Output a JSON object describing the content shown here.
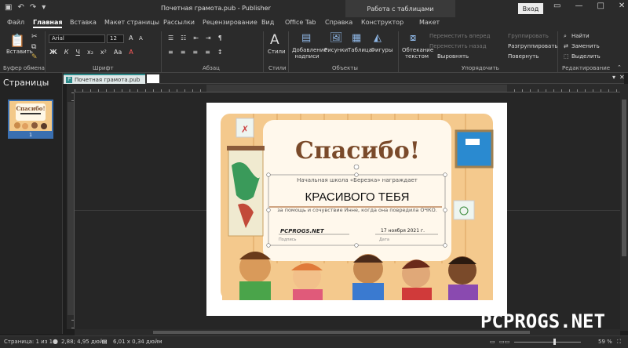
{
  "titlebar": {
    "title": "Почетная грамота.pub  -  Publisher",
    "context_tab": "Работа с таблицами",
    "login": "Вход",
    "qat_icons": [
      "save-icon",
      "undo-icon",
      "redo-icon",
      "customize-icon"
    ]
  },
  "tabs": [
    {
      "label": "Файл"
    },
    {
      "label": "Главная"
    },
    {
      "label": "Вставка"
    },
    {
      "label": "Макет страницы"
    },
    {
      "label": "Рассылки"
    },
    {
      "label": "Рецензирование"
    },
    {
      "label": "Вид"
    },
    {
      "label": "Office Tab"
    },
    {
      "label": "Справка"
    },
    {
      "label": "Конструктор"
    },
    {
      "label": "Макет"
    }
  ],
  "ribbon": {
    "paste": "Вставить",
    "font_name": "Arial",
    "font_size": "12",
    "styles": "Стили",
    "add_textbox": "Добавление надписи",
    "pictures": "Рисунки",
    "table": "Таблица",
    "shapes": "Фигуры",
    "wrap_text": "Обтекание текстом",
    "bring_forward": "Переместить вперед",
    "send_backward": "Переместить назад",
    "align": "Выровнять",
    "group": "Группировать",
    "ungroup": "Разгруппировать",
    "rotate": "Повернуть",
    "find": "Найти",
    "replace": "Заменить",
    "select": "Выделить",
    "groups": {
      "clipboard": "Буфер обмена",
      "font": "Шрифт",
      "paragraph": "Абзац",
      "styles": "Стили",
      "objects": "Объекты",
      "arrange": "Упорядочить",
      "editing": "Редактирование"
    }
  },
  "pages_pane": {
    "title": "Страницы",
    "page_number": "1"
  },
  "document_tab": {
    "name": "Почетная грамота.pub"
  },
  "certificate": {
    "heading": "Спасибо!",
    "presenter": "Начальная школа «Березка» награждает",
    "recipient": "КРАСИВОГО ТЕБЯ",
    "reason": "за помощь и сочувствие Инне, когда она повредила ОЧКО.",
    "signature": "PCPROGS.NET",
    "signature_label": "Подпись",
    "date": "17 ноября 2021  г.",
    "date_label": "Дата"
  },
  "status": {
    "page": "Страница: 1 из 1",
    "position": "2,88; 4,95 дюйм",
    "size": "6,01 x 0,34 дюйм",
    "zoom": "59 %"
  },
  "watermark": "PCPROGS.NET",
  "colors": {
    "accent_tab": "#2e8b8b",
    "selection": "#3a6fb0",
    "heading_brown": "#7a4a2a"
  }
}
